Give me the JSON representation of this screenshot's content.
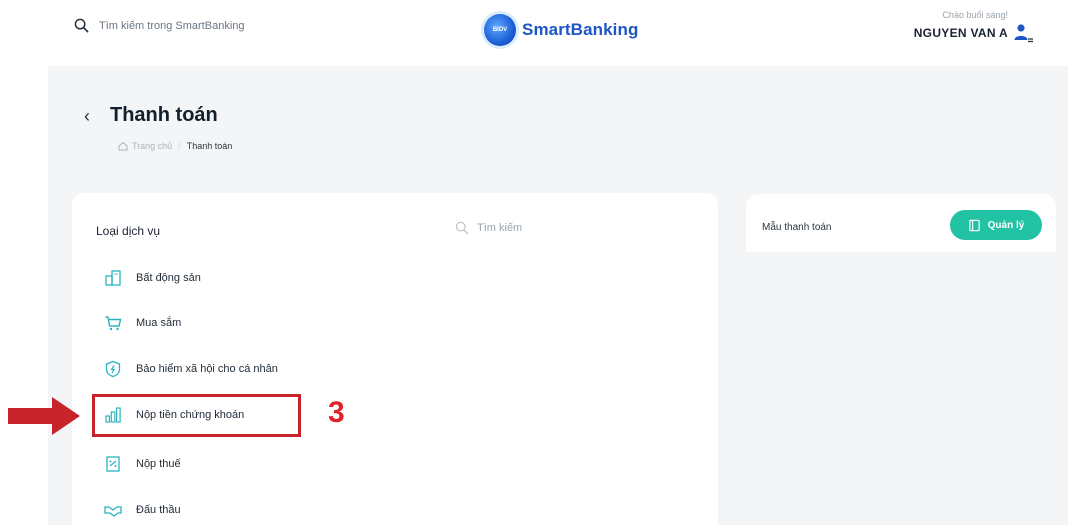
{
  "header": {
    "search_placeholder": "Tìm kiếm trong SmartBanking",
    "logo_badge": "BIDV",
    "logo_text": "SmartBanking",
    "greeting": "Chào buổi sáng!",
    "user_name": "NGUYEN VAN A"
  },
  "page": {
    "title": "Thanh toán",
    "breadcrumb": [
      {
        "label": "Trang chủ"
      },
      {
        "label": "Thanh toán"
      }
    ]
  },
  "services_panel": {
    "title": "Loại dịch vụ",
    "search_placeholder": "Tìm kiếm",
    "items": [
      {
        "label": "Bất động sản",
        "icon": "building-icon"
      },
      {
        "label": "Mua sắm",
        "icon": "cart-icon"
      },
      {
        "label": "Bảo hiểm xã hội cho cá nhân",
        "icon": "shield-icon"
      },
      {
        "label": "Nộp tiền chứng khoán",
        "icon": "stock-chart-icon"
      },
      {
        "label": "Nộp thuế",
        "icon": "tax-document-icon"
      },
      {
        "label": "Đấu thầu",
        "icon": "handshake-icon"
      }
    ]
  },
  "templates_card": {
    "label": "Mẫu thanh toán",
    "manage_label": "Quản lý"
  },
  "annotation": {
    "step_number": "3"
  },
  "colors": {
    "accent_teal": "#22c3a5",
    "brand_blue": "#1d56c7",
    "annotation_red": "#c8232a",
    "icon_teal": "#2bb3c0"
  }
}
